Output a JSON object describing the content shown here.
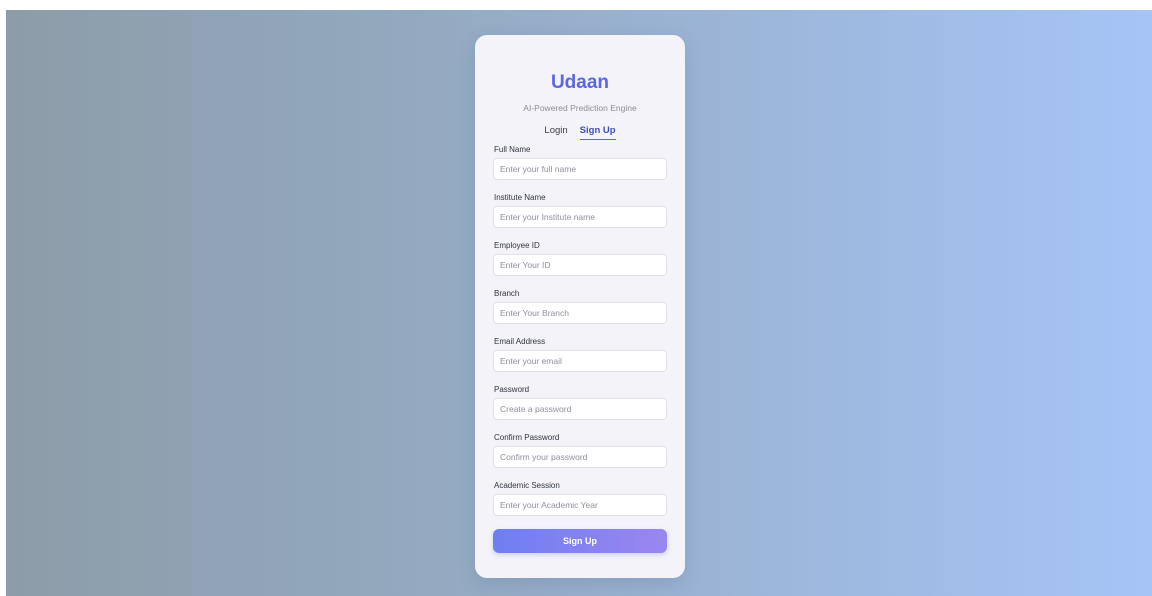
{
  "app": {
    "title": "Udaan",
    "tagline": "AI-Powered Prediction Engine"
  },
  "tabs": [
    {
      "label": "Login",
      "active": false
    },
    {
      "label": "Sign Up",
      "active": true
    }
  ],
  "form": {
    "fields": [
      {
        "label": "Full Name",
        "placeholder": "Enter your full name",
        "value": ""
      },
      {
        "label": "Institute Name",
        "placeholder": "Enter your Institute name",
        "value": ""
      },
      {
        "label": "Employee ID",
        "placeholder": "Enter Your ID",
        "value": ""
      },
      {
        "label": "Branch",
        "placeholder": "Enter Your Branch",
        "value": ""
      },
      {
        "label": "Email Address",
        "placeholder": "Enter your email",
        "value": ""
      },
      {
        "label": "Password",
        "placeholder": "Create a password",
        "value": ""
      },
      {
        "label": "Confirm Password",
        "placeholder": "Confirm your password",
        "value": ""
      },
      {
        "label": "Academic Session",
        "placeholder": "Enter your Academic Year",
        "value": ""
      }
    ],
    "submit_label": "Sign Up"
  },
  "colors": {
    "brand": "#5b68e0",
    "button_start": "#6e7ff0",
    "button_end": "#9b86f0",
    "card_background": "#f4f3f9"
  }
}
